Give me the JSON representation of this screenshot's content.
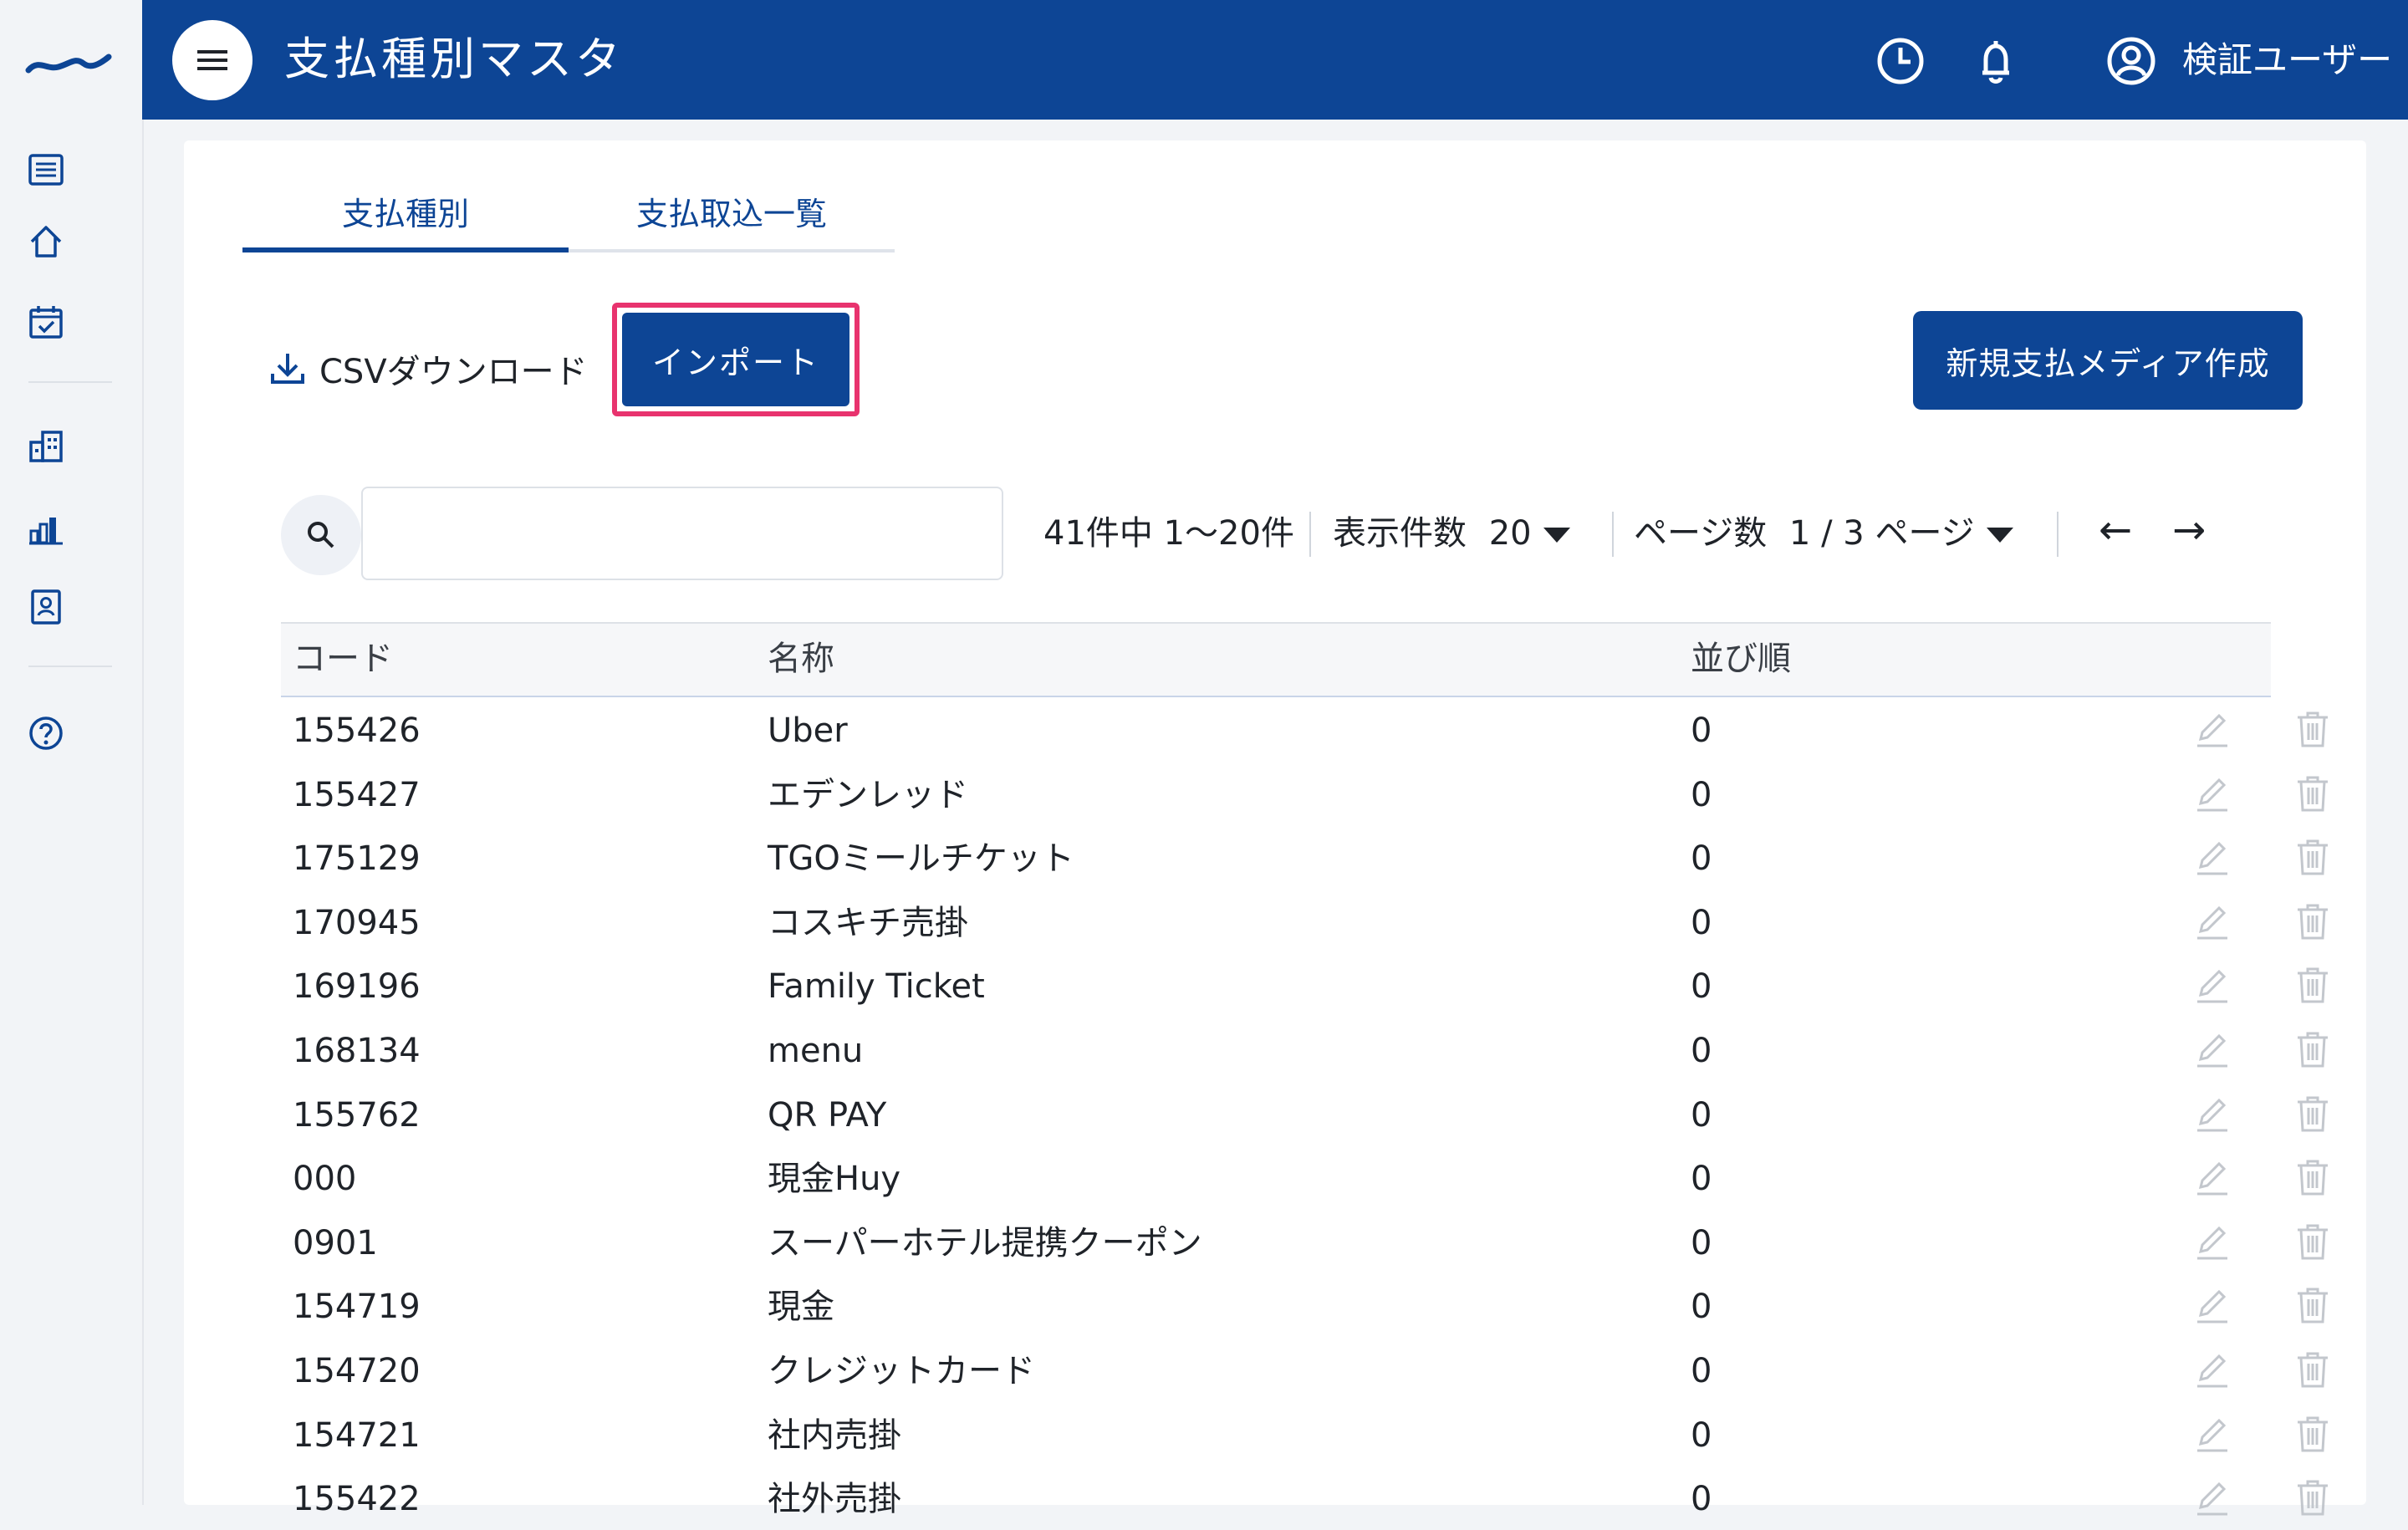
{
  "header": {
    "title": "支払種別マスタ",
    "user_name": "検証ユーザー"
  },
  "tabs": [
    {
      "label": "支払種別",
      "active": true
    },
    {
      "label": "支払取込一覧",
      "active": false
    }
  ],
  "toolbar": {
    "csv_download": "CSVダウンロード",
    "import": "インポート",
    "new_media": "新規支払メディア作成"
  },
  "search": {
    "value": "",
    "placeholder": ""
  },
  "pager": {
    "summary": "41件中 1〜20件",
    "per_page_label": "表示件数",
    "per_page_value": "20",
    "page_label": "ページ数",
    "page_value": "1 / 3 ページ",
    "prev": "←",
    "next": "→"
  },
  "table": {
    "columns": {
      "code": "コード",
      "name": "名称",
      "order": "並び順"
    },
    "rows": [
      {
        "code": "155426",
        "name": "Uber",
        "order": "0"
      },
      {
        "code": "155427",
        "name": "エデンレッド",
        "order": "0"
      },
      {
        "code": "175129",
        "name": "TGOミールチケット",
        "order": "0"
      },
      {
        "code": "170945",
        "name": "コスキチ売掛",
        "order": "0"
      },
      {
        "code": "169196",
        "name": "Family Ticket",
        "order": "0"
      },
      {
        "code": "168134",
        "name": "menu",
        "order": "0"
      },
      {
        "code": "155762",
        "name": "QR PAY",
        "order": "0"
      },
      {
        "code": "000",
        "name": "現金Huy",
        "order": "0"
      },
      {
        "code": "0901",
        "name": "スーパーホテル提携クーポン",
        "order": "0"
      },
      {
        "code": "154719",
        "name": "現金",
        "order": "0"
      },
      {
        "code": "154720",
        "name": "クレジットカード",
        "order": "0"
      },
      {
        "code": "154721",
        "name": "社内売掛",
        "order": "0"
      },
      {
        "code": "155422",
        "name": "社外売掛",
        "order": "0"
      }
    ]
  },
  "colors": {
    "primary": "#0d4595",
    "highlight": "#e8336e"
  }
}
